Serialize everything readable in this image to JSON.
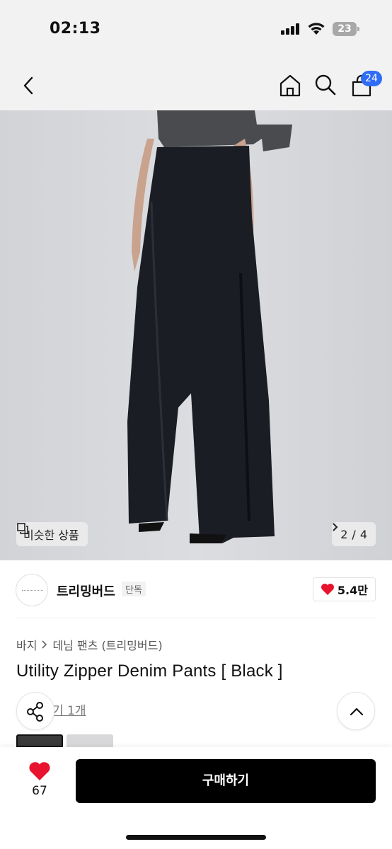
{
  "status_bar": {
    "time": "02:13",
    "battery_level": "23",
    "icons": [
      "signal-icon",
      "wifi-icon",
      "battery-icon"
    ]
  },
  "nav": {
    "icons": [
      "back-icon",
      "home-icon",
      "search-icon",
      "cart-icon"
    ],
    "cart_badge": "24",
    "badge_color": "#2f6df6"
  },
  "hero": {
    "similar_label": "비슷한 상품",
    "page_current": "2",
    "page_separator": "/",
    "page_total": "4"
  },
  "brand": {
    "name": "트리밍버드",
    "tag": "단독",
    "likes": "5.4만",
    "heart_color": "#e8132e"
  },
  "product": {
    "breadcrumb": [
      "바지",
      "데님 팬츠 (트리밍버드)"
    ],
    "title": "Utility Zipper Denim Pants [ Black ]",
    "review_link": "기 1개"
  },
  "bottom_bar": {
    "like_count": "67",
    "buy_label": "구매하기",
    "buy_color": "#000000"
  }
}
